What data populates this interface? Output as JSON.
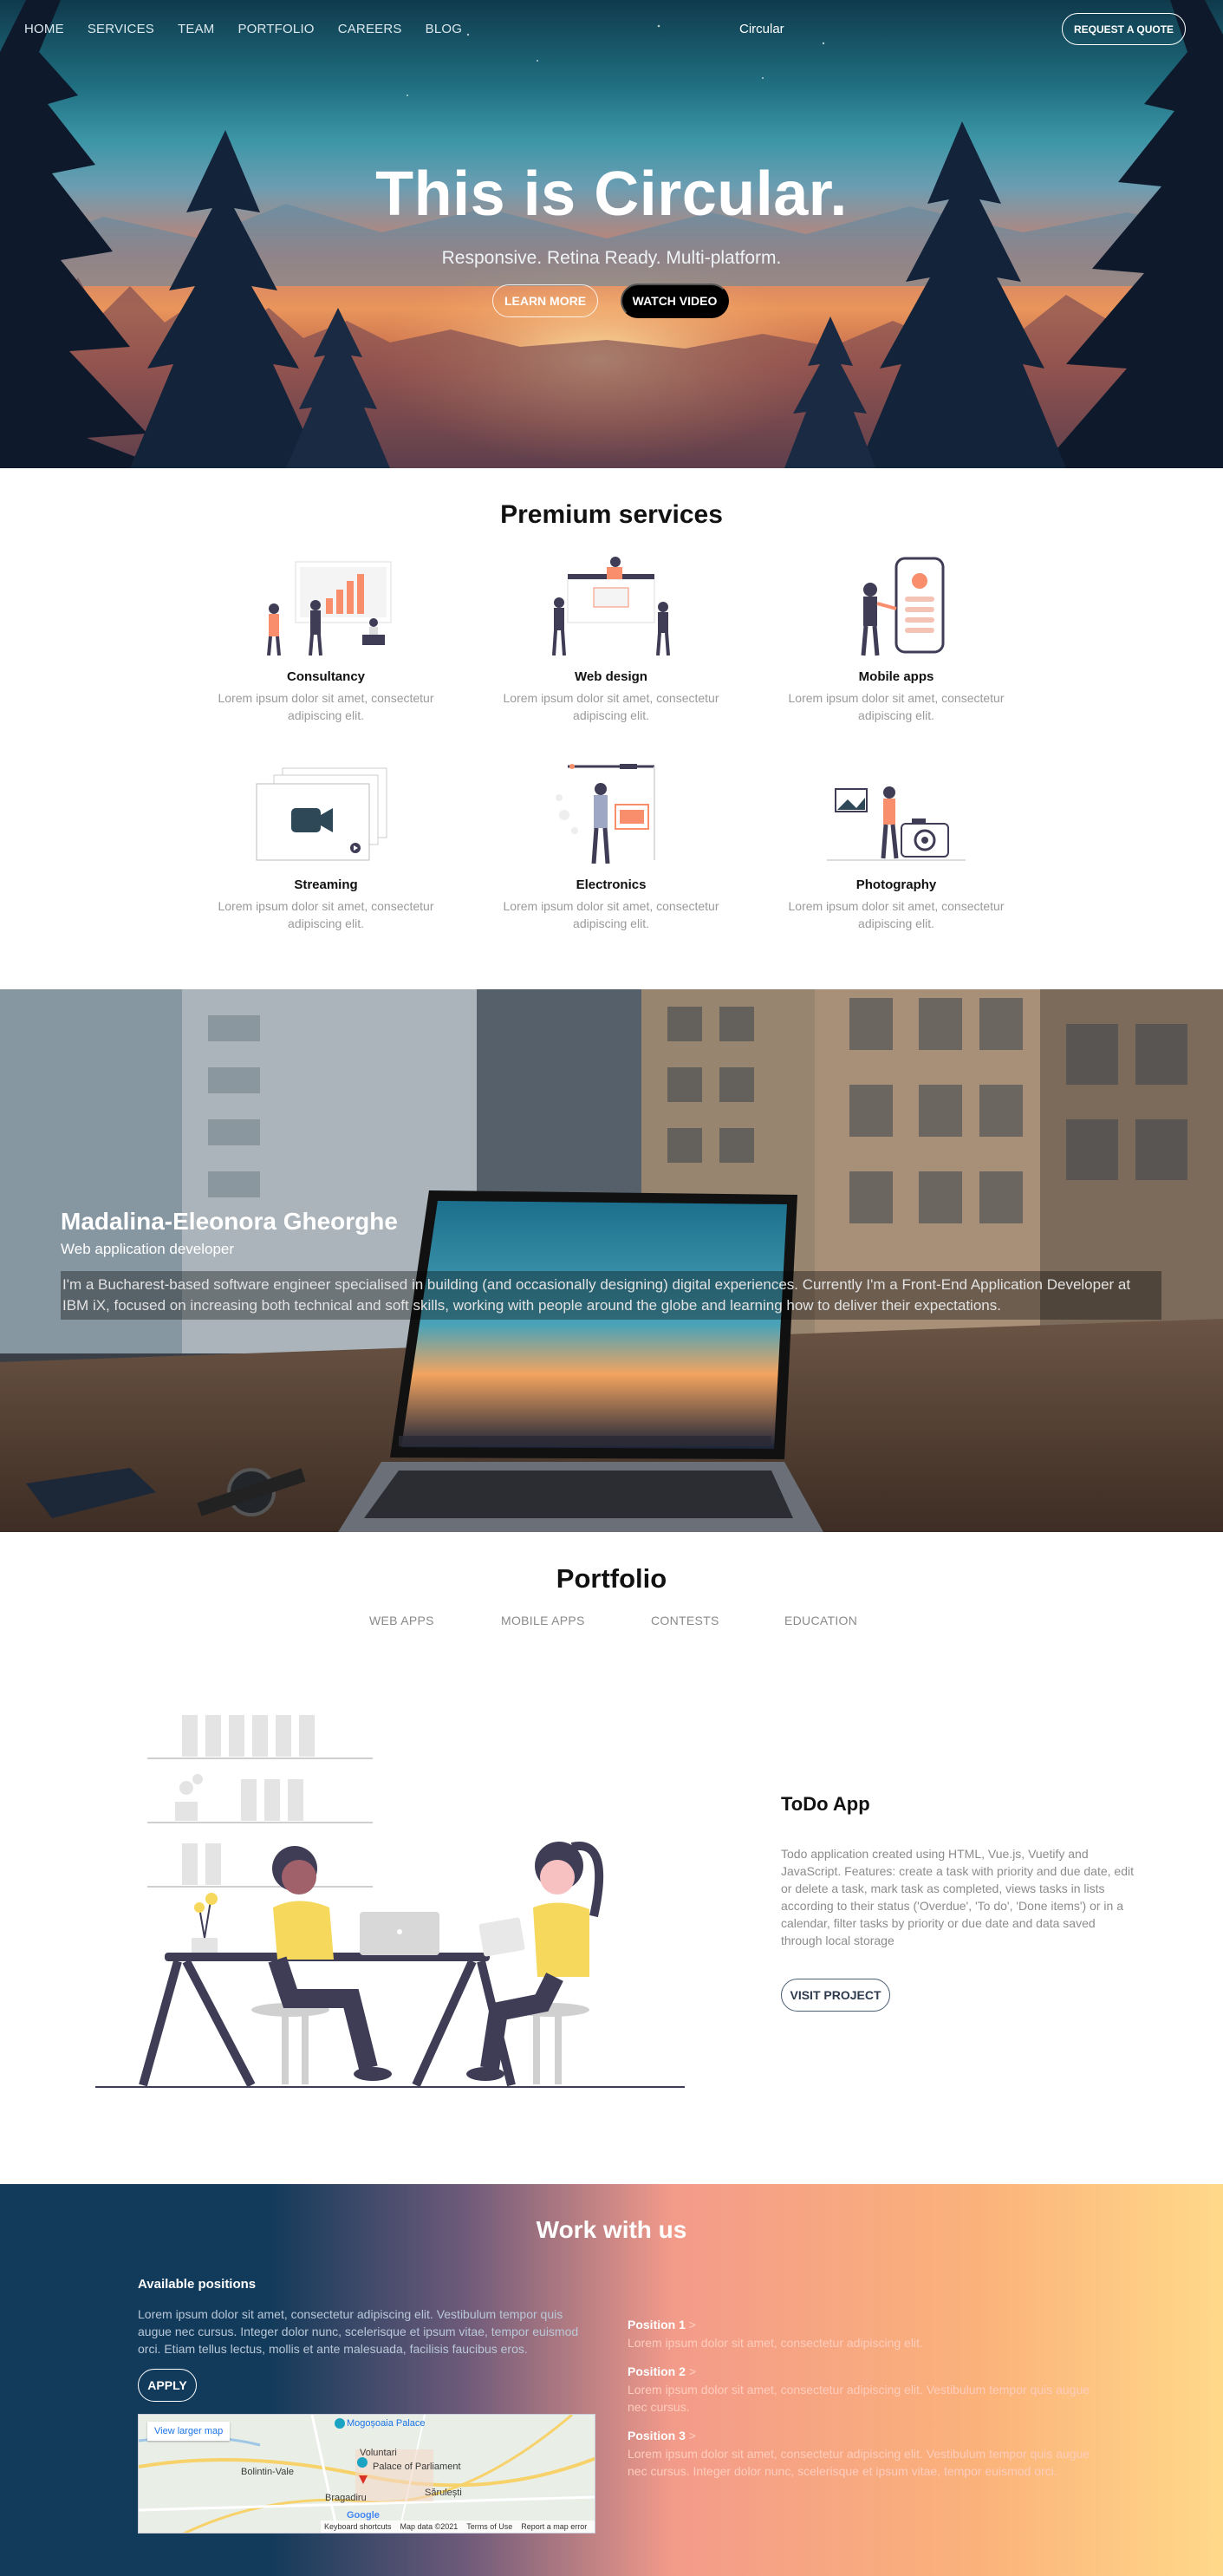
{
  "nav": {
    "links": [
      "HOME",
      "SERVICES",
      "TEAM",
      "PORTFOLIO",
      "CAREERS",
      "BLOG"
    ],
    "brand": "Circular",
    "quote_button": "REQUEST A QUOTE"
  },
  "hero": {
    "title": "This is Circular.",
    "subtitle": "Responsive. Retina Ready. Multi-platform.",
    "learn_more": "LEARN MORE",
    "watch_video": "WATCH VIDEO"
  },
  "services": {
    "title": "Premium services",
    "items": [
      {
        "name": "Consultancy",
        "desc": "Lorem ipsum dolor sit amet, consectetur adipiscing elit.",
        "icon": "consultancy-illustration"
      },
      {
        "name": "Web design",
        "desc": "Lorem ipsum dolor sit amet, consectetur adipiscing elit.",
        "icon": "web-design-illustration"
      },
      {
        "name": "Mobile apps",
        "desc": "Lorem ipsum dolor sit amet, consectetur adipiscing elit.",
        "icon": "mobile-apps-illustration"
      },
      {
        "name": "Streaming",
        "desc": "Lorem ipsum dolor sit amet, consectetur adipiscing elit.",
        "icon": "streaming-illustration"
      },
      {
        "name": "Electronics",
        "desc": "Lorem ipsum dolor sit amet, consectetur adipiscing elit.",
        "icon": "electronics-illustration"
      },
      {
        "name": "Photography",
        "desc": "Lorem ipsum dolor sit amet, consectetur adipiscing elit.",
        "icon": "photography-illustration"
      }
    ]
  },
  "profile": {
    "name": "Madalina-Eleonora Gheorghe",
    "role": "Web application developer",
    "bio": "I'm a Bucharest-based software engineer specialised in building (and occasionally designing) digital experiences. Currently I'm a Front-End Application Developer at IBM iX, focused on increasing both technical and soft skills, working with people around the globe and learning how to deliver their expectations."
  },
  "portfolio": {
    "title": "Portfolio",
    "filters": [
      "WEB APPS",
      "MOBILE APPS",
      "CONTESTS",
      "EDUCATION"
    ],
    "project": {
      "title": "ToDo App",
      "desc": "Todo application created using HTML, Vue.js, Vuetify and JavaScript. Features: create a task with priority and due date, edit or delete a task, mark task as completed, views tasks in lists according to their status ('Overdue', 'To do', 'Done items') or in a calendar, filter tasks by priority or due date and data saved through local storage",
      "button": "VISIT PROJECT"
    }
  },
  "work": {
    "title": "Work with us",
    "available_title": "Available positions",
    "available_text": "Lorem ipsum dolor sit amet, consectetur adipiscing elit. Vestibulum tempor quis augue nec cursus. Integer dolor nunc, scelerisque et ipsum vitae, tempor euismod orci. Etiam tellus lectus, mollis et ante malesuada, facilisis faucibus eros.",
    "apply": "APPLY",
    "map": {
      "larger": "View larger map",
      "labels": [
        "Mogoșoaia Palace",
        "Voluntari",
        "Bolintin-Vale",
        "Palace of Parliament",
        "Bragadiru",
        "Sărulești",
        "Google"
      ],
      "footer": [
        "Keyboard shortcuts",
        "Map data ©2021",
        "Terms of Use",
        "Report a map error"
      ]
    },
    "positions": [
      {
        "title": "Position 1",
        "arrow": ">",
        "text": "Lorem ipsum dolor sit amet, consectetur adipiscing elit."
      },
      {
        "title": "Position 2",
        "arrow": ">",
        "text": "Lorem ipsum dolor sit amet, consectetur adipiscing elit. Vestibulum tempor quis augue nec cursus."
      },
      {
        "title": "Position 3",
        "arrow": ">",
        "text": "Lorem ipsum dolor sit amet, consectetur adipiscing elit. Vestibulum tempor quis augue nec cursus. Integer dolor nunc, scelerisque et ipsum vitae, tempor euismod orci."
      }
    ]
  },
  "colors": {
    "accent_dark": "#123a5a",
    "accent_warm": "#f39b8a",
    "illustration_yellow": "#f5d85c",
    "illustration_navy": "#3f3d56",
    "illustration_coral": "#f98e6c"
  }
}
